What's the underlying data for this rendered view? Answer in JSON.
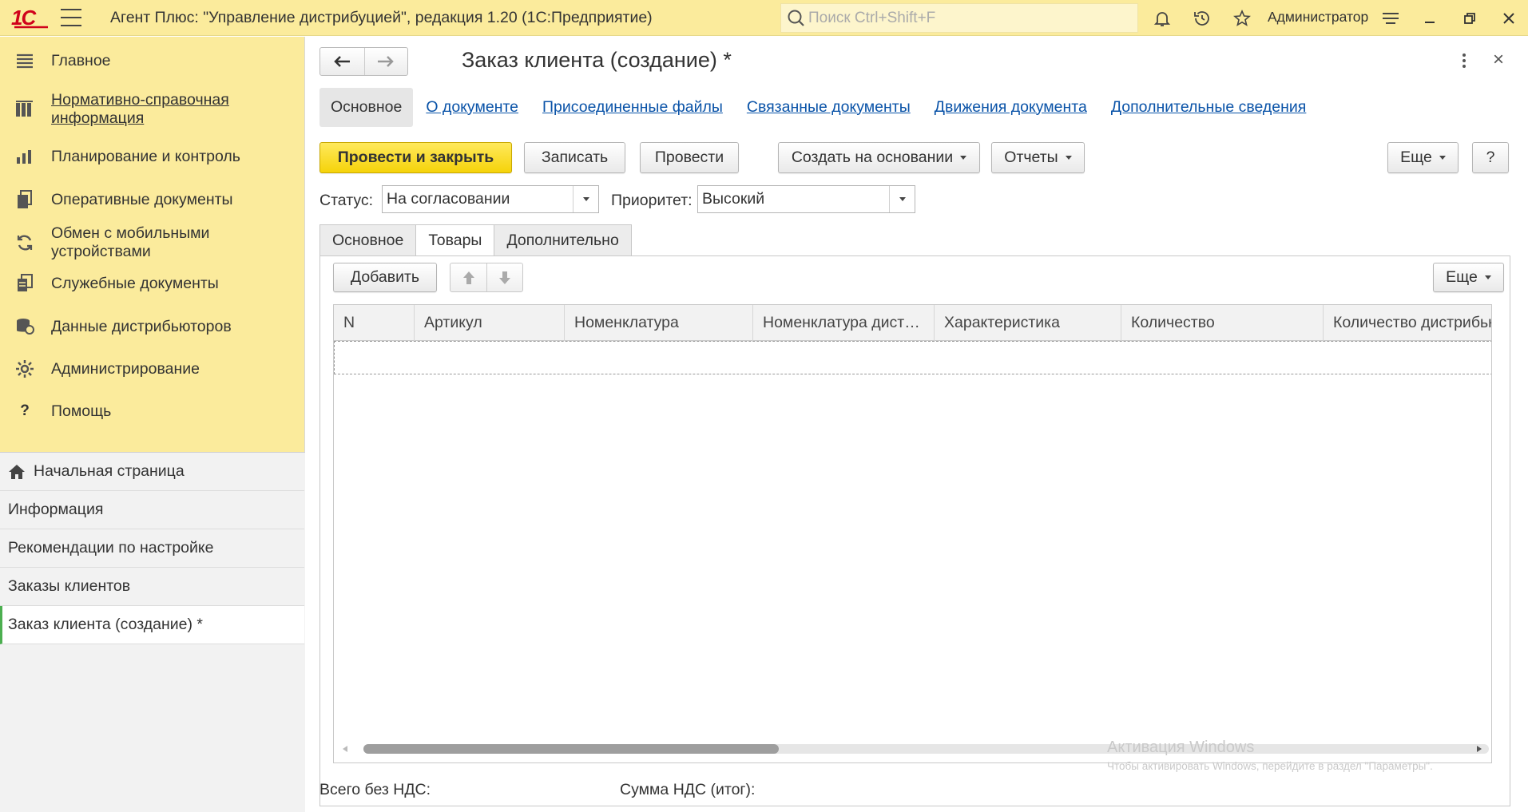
{
  "titlebar": {
    "logo_text": "1С",
    "app_title": "Агент Плюс: \"Управление дистрибуцией\", редакция 1.20  (1С:Предприятие)",
    "search_placeholder": "Поиск Ctrl+Shift+F",
    "user": "Администратор"
  },
  "sidebar": {
    "items": [
      {
        "label": "Главное",
        "icon": "menu-lines-icon"
      },
      {
        "label": "Нормативно-справочная информация",
        "icon": "books-icon"
      },
      {
        "label": "Планирование и контроль",
        "icon": "bar-chart-icon"
      },
      {
        "label": "Оперативные документы",
        "icon": "documents-icon"
      },
      {
        "label": "Обмен с мобильными устройствами",
        "icon": "sync-icon"
      },
      {
        "label": "Служебные документы",
        "icon": "service-docs-icon"
      },
      {
        "label": "Данные дистрибьюторов",
        "icon": "database-icon"
      },
      {
        "label": "Администрирование",
        "icon": "gear-icon"
      },
      {
        "label": "Помощь",
        "icon": "question-icon"
      }
    ],
    "open_windows": [
      {
        "label": "Начальная страница",
        "icon": "home-icon"
      },
      {
        "label": "Информация"
      },
      {
        "label": "Рекомендации по настройке"
      },
      {
        "label": "Заказы клиентов"
      },
      {
        "label": "Заказ клиента (создание) *"
      }
    ]
  },
  "document": {
    "title": "Заказ клиента (создание) *",
    "nav": {
      "active": "Основное",
      "links": [
        "О документе",
        "Присоединенные файлы",
        "Связанные документы",
        "Движения документа",
        "Дополнительные сведения"
      ]
    },
    "toolbar": {
      "post_close": "Провести и закрыть",
      "save": "Записать",
      "post": "Провести",
      "create_based": "Создать на основании",
      "reports": "Отчеты",
      "more": "Еще",
      "help": "?"
    },
    "status": {
      "label": "Статус:",
      "value": "На согласовании"
    },
    "priority": {
      "label": "Приоритет:",
      "value": "Высокий"
    },
    "tabs": [
      "Основное",
      "Товары",
      "Дополнительно"
    ],
    "active_tab": "Товары",
    "table_toolbar": {
      "add": "Добавить",
      "more": "Еще"
    },
    "table": {
      "columns": [
        "N",
        "Артикул",
        "Номенклатура",
        "Номенклатура дист…",
        "Характеристика",
        "Количество",
        "Количество дистрибьютора"
      ],
      "rows": []
    },
    "totals": {
      "without_vat": "Всего без НДС:",
      "vat_total": "Сумма НДС (итог):"
    }
  },
  "watermark": {
    "line1": "Активация Windows",
    "line2": "Чтобы активировать Windows, перейдите в раздел \"Параметры\"."
  },
  "colors": {
    "accent_yellow": "#fbeb9c",
    "primary_button": "#f5d30a",
    "link": "#0a53a8"
  }
}
